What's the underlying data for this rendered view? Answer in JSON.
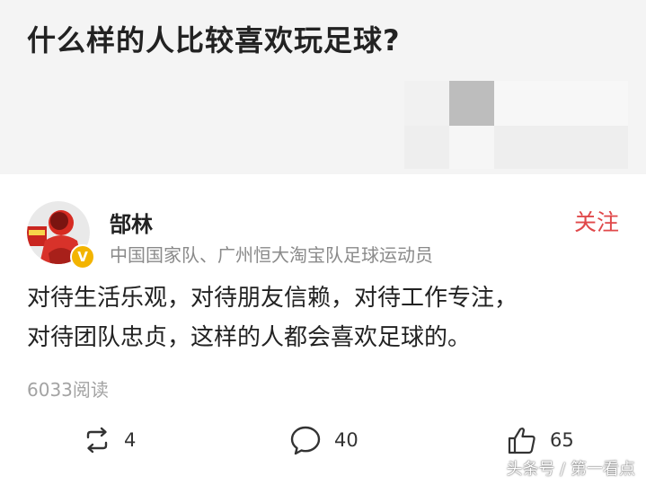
{
  "question": {
    "title": "什么样的人比较喜欢玩足球?"
  },
  "answer": {
    "author": {
      "name": "郜林",
      "description": "中国国家队、广州恒大淘宝队足球运动员",
      "verified_mark": "V"
    },
    "follow_label": "关注",
    "content_lines": [
      "对待生活乐观，对待朋友信赖，对待工作专注，",
      "对待团队忠贞，这样的人都会喜欢足球的。"
    ],
    "read_count": "6033阅读",
    "actions": {
      "repost": {
        "icon": "repost-icon",
        "count": "4"
      },
      "comment": {
        "icon": "comment-icon",
        "count": "40"
      },
      "like": {
        "icon": "thumbs-up-icon",
        "count": "65"
      }
    }
  },
  "watermark": "头条号 / 第一看点",
  "colors": {
    "background": "#f4f4f4",
    "card": "#ffffff",
    "follow": "#e0484a",
    "secondary_text": "#8a8a8a",
    "badge": "#f3b400"
  }
}
